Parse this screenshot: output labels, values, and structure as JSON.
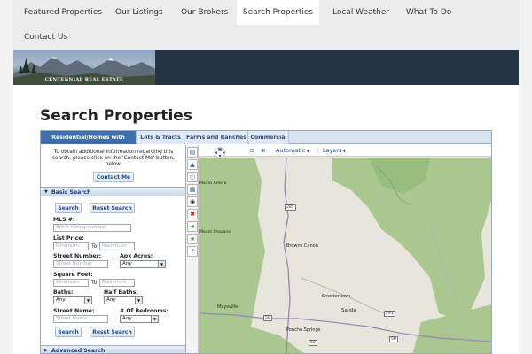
{
  "nav": {
    "items": [
      {
        "label": "Featured Properties"
      },
      {
        "label": "Our Listings"
      },
      {
        "label": "Our Brokers"
      },
      {
        "label": "Search Properties",
        "active": true
      },
      {
        "label": "Local Weather"
      },
      {
        "label": "What To Do"
      },
      {
        "label": "Contact Us"
      }
    ]
  },
  "header": {
    "logo_text": "CENTENNIAL REAL ESTATE",
    "banner_color": "#263543"
  },
  "page": {
    "title": "Search Properties"
  },
  "search_app": {
    "tabs": [
      {
        "label": "Residential/Homes with Acreage",
        "active": true
      },
      {
        "label": "Lots & Tracts"
      },
      {
        "label": "Farms and Ranches"
      },
      {
        "label": "Commercial"
      }
    ],
    "info_text": "To obtain additional information regarding this search, please click on the 'Contact Me' button, below.",
    "contact_button": "Contact Me",
    "basic_search": {
      "heading": "Basic Search",
      "search_button": "Search",
      "reset_button": "Reset Search",
      "mls_label": "MLS #:",
      "mls_placeholder": "Enter listing number",
      "list_price_label": "List Price:",
      "min_placeholder": "Minimum",
      "to_text": "To",
      "max_placeholder": "Maximum",
      "street_number_label": "Street Number:",
      "street_number_placeholder": "Street Number",
      "apx_acres_label": "Apx Acres:",
      "apx_acres_value": "Any",
      "square_feet_label": "Square Feet:",
      "baths_label": "Baths:",
      "baths_value": "Any",
      "half_baths_label": "Half Baths:",
      "half_baths_value": "Any",
      "street_name_label": "Street Name:",
      "street_name_placeholder": "Street Name",
      "bedrooms_label": "# Of Bedrooms:",
      "bedrooms_value": "Any"
    },
    "advanced_search": {
      "heading": "Advanced Search"
    },
    "map": {
      "compass_label": "N",
      "map_type": "Automatic",
      "layers_label": "Layers",
      "places": [
        "Browns Canon",
        "Smeltertown",
        "Salida",
        "Maysville",
        "Poncha Springs",
        "Mount Shavano",
        "Mount Antero"
      ],
      "road_labels": [
        "285",
        "50",
        "50",
        "291",
        "50"
      ],
      "forest_color": "#a8c78e",
      "terrain_color": "#e8e6dc"
    },
    "tools": [
      "chart-bar-icon",
      "chart-area-icon",
      "circle-icon",
      "grid-icon",
      "binoculars-icon",
      "close-icon",
      "sign-icon",
      "star-icon",
      "help-icon"
    ]
  }
}
